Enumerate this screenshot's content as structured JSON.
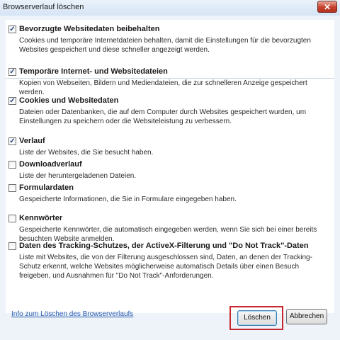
{
  "window": {
    "title": "Browserverlauf löschen",
    "close_label": "✕"
  },
  "options": [
    {
      "checked": true,
      "title": "Bevorzugte Websitedaten beibehalten",
      "desc": "Cookies und temporäre Internetdateien behalten, damit die Einstellungen für die bevorzugten Websites gespeichert und diese schneller angezeigt werden."
    },
    {
      "checked": true,
      "title": "Temporäre Internet- und Websitedateien",
      "desc": "Kopien von Webseiten, Bildern und Mediendateien, die zur schnelleren Anzeige gespeichert werden."
    },
    {
      "checked": true,
      "title": "Cookies und Websitedaten",
      "desc": "Dateien oder Datenbanken, die auf dem Computer durch Websites gespeichert wurden, um Einstellungen zu speichern oder die Websiteleistung zu verbessern."
    },
    {
      "checked": true,
      "title": "Verlauf",
      "desc": "Liste der Websites, die Sie besucht haben."
    },
    {
      "checked": false,
      "title": "Downloadverlauf",
      "desc": "Liste der heruntergeladenen Dateien."
    },
    {
      "checked": false,
      "title": "Formulardaten",
      "desc": "Gespeicherte Informationen, die Sie in Formulare eingegeben haben."
    },
    {
      "checked": false,
      "title": "Kennwörter",
      "desc": "Gespeicherte Kennwörter, die automatisch eingegeben werden, wenn Sie sich bei einer bereits besuchten Website anmelden."
    },
    {
      "checked": false,
      "title": "Daten des Tracking-Schutzes, der ActiveX-Filterung und \"Do Not Track\"-Daten",
      "desc": "Liste mit Websites, die von der Filterung ausgeschlossen sind, Daten, an denen der Tracking-Schutz erkennt, welche Websites möglicherweise automatisch Details über einen Besuch freigeben, und Ausnahmen für \"Do Not Track\"-Anforderungen."
    }
  ],
  "footer": {
    "help_link": "Info zum Löschen des Browserverlaufs",
    "delete_label": "Löschen",
    "cancel_label": "Abbrechen"
  }
}
